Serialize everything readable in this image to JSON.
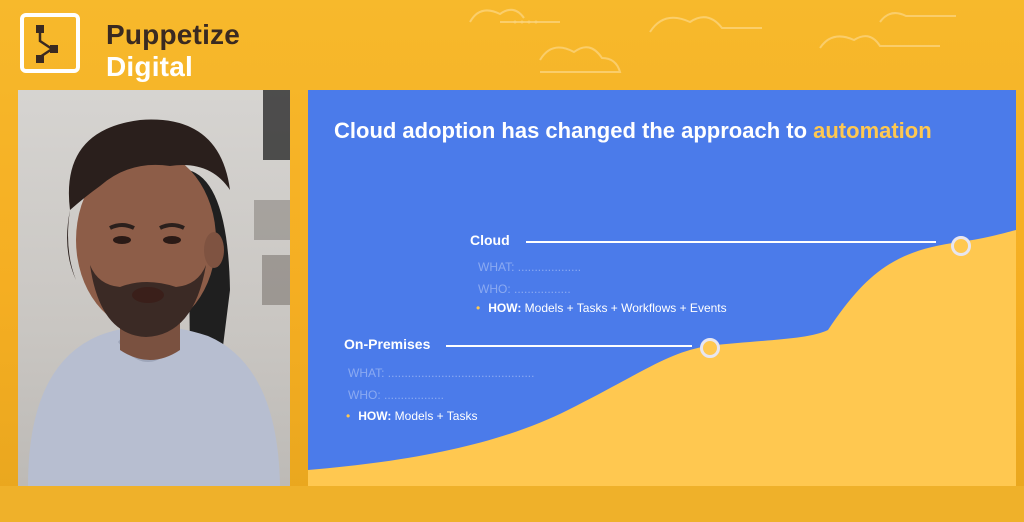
{
  "brand": {
    "line1": "Puppetize",
    "line2": "Digital"
  },
  "slide": {
    "title_main": "Cloud adoption has changed the approach to ",
    "title_highlight": "automation",
    "cloud": {
      "label": "Cloud",
      "bullet_faded_1": "WHAT: ...................",
      "bullet_faded_2": "WHO: .................",
      "how_label": "HOW:",
      "how_value": " Models + Tasks + Workflows + Events"
    },
    "onprem": {
      "label": "On-Premises",
      "bullet_faded_1": "WHAT: ............................................",
      "bullet_faded_2": "WHO: ..................",
      "how_label": "HOW:",
      "how_value": " Models + Tasks"
    }
  },
  "colors": {
    "background": "#f5ae22",
    "slide": "#4b7bea",
    "accent": "#ffc850"
  }
}
